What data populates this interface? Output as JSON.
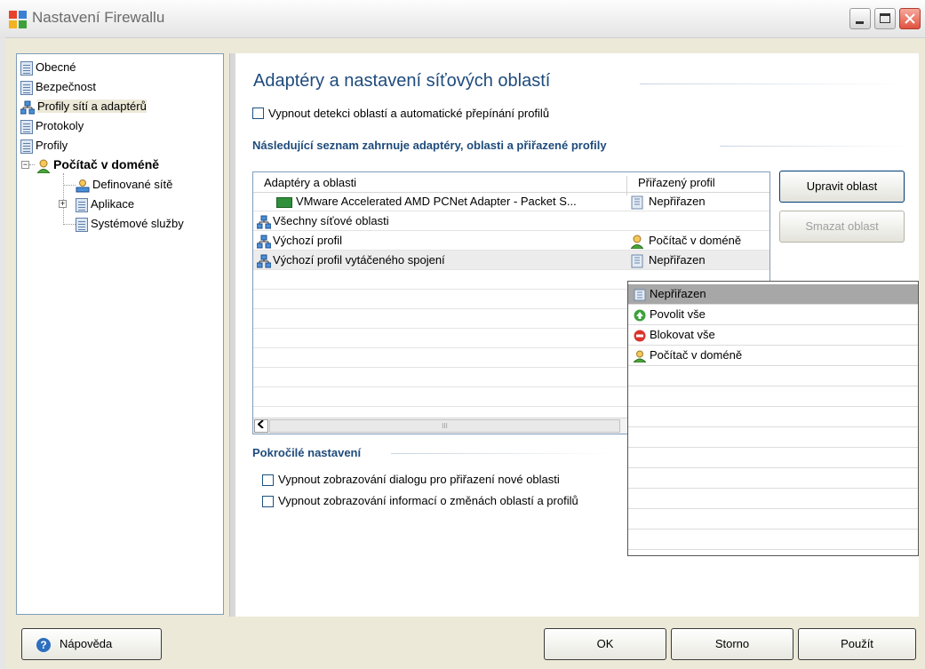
{
  "window": {
    "title": "Nastavení Firewallu"
  },
  "tree": {
    "items": [
      {
        "label": "Obecné"
      },
      {
        "label": "Bezpečnost"
      },
      {
        "label": "Profily sítí a adaptérů"
      },
      {
        "label": "Protokoly"
      },
      {
        "label": "Profily"
      },
      {
        "label": "Počítač v doméně"
      },
      {
        "label": "Definované sítě"
      },
      {
        "label": "Aplikace"
      },
      {
        "label": "Systémové služby"
      }
    ]
  },
  "main": {
    "title": "Adaptéry a nastavení síťových oblastí",
    "disable_detection_label": "Vypnout detekci oblastí a automatické přepínání profilů",
    "list_heading": "Následující seznam zahrnuje adaptéry, oblasti a přiřazené profily",
    "columns": {
      "col1": "Adaptéry a oblasti",
      "col2": "Přiřazený profil"
    },
    "rows": [
      {
        "name": "VMware Accelerated AMD PCNet Adapter - Packet S...",
        "profile": "Nepřiřazen"
      },
      {
        "name": "Všechny síťové oblasti",
        "profile": ""
      },
      {
        "name": "Výchozí profil",
        "profile": "Počítač v doméně"
      },
      {
        "name": "Výchozí profil vytáčeného spojení",
        "profile": "Nepřiřazen"
      }
    ],
    "scroll_thumb_glyph": "III",
    "edit_area_button": "Upravit oblast",
    "delete_area_button": "Smazat oblast",
    "advanced_heading": "Pokročilé nastavení",
    "adv_option1": "Vypnout zobrazování dialogu pro přiřazení nové oblasti",
    "adv_option2": "Vypnout zobrazování informací o změnách oblastí a profilů"
  },
  "dropdown": {
    "options": [
      {
        "label": "Nepřiřazen",
        "icon": "unassigned-icon"
      },
      {
        "label": "Povolit vše",
        "icon": "allow-all-icon"
      },
      {
        "label": "Blokovat vše",
        "icon": "block-all-icon"
      },
      {
        "label": "Počítač v doméně",
        "icon": "domain-computer-icon"
      }
    ],
    "selected": "Nepřiřazen"
  },
  "footer": {
    "help": "Nápověda",
    "ok": "OK",
    "cancel": "Storno",
    "apply": "Použít"
  },
  "colors": {
    "heading": "#1e4b7c",
    "window_bg": "#ece9d8",
    "selected_item": "#a7a7a7"
  }
}
